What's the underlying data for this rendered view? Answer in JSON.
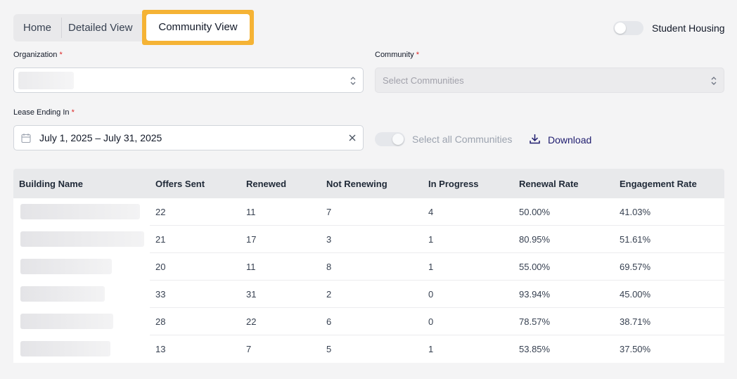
{
  "tabs": [
    {
      "label": "Home"
    },
    {
      "label": "Detailed View"
    },
    {
      "label": "Community View",
      "active": true
    }
  ],
  "student_housing": {
    "label": "Student Housing",
    "on": false
  },
  "organization": {
    "label": "Organization",
    "required": "*",
    "value": ""
  },
  "community": {
    "label": "Community",
    "required": "*",
    "placeholder": "Select Communities"
  },
  "lease": {
    "label": "Lease Ending In",
    "required": "*",
    "value": "July 1, 2025 – July 31, 2025"
  },
  "select_all": {
    "label": "Select all Communities"
  },
  "download": {
    "label": "Download"
  },
  "table": {
    "headers": [
      "Building Name",
      "Offers Sent",
      "Renewed",
      "Not Renewing",
      "In Progress",
      "Renewal Rate",
      "Engagement Rate"
    ],
    "rows": [
      {
        "building": "",
        "offers": "22",
        "renewed": "11",
        "not_renewing": "7",
        "in_progress": "4",
        "renewal_rate": "50.00%",
        "engagement_rate": "41.03%"
      },
      {
        "building": "",
        "offers": "21",
        "renewed": "17",
        "not_renewing": "3",
        "in_progress": "1",
        "renewal_rate": "80.95%",
        "engagement_rate": "51.61%"
      },
      {
        "building": "",
        "offers": "20",
        "renewed": "11",
        "not_renewing": "8",
        "in_progress": "1",
        "renewal_rate": "55.00%",
        "engagement_rate": "69.57%"
      },
      {
        "building": "",
        "offers": "33",
        "renewed": "31",
        "not_renewing": "2",
        "in_progress": "0",
        "renewal_rate": "93.94%",
        "engagement_rate": "45.00%"
      },
      {
        "building": "",
        "offers": "28",
        "renewed": "22",
        "not_renewing": "6",
        "in_progress": "0",
        "renewal_rate": "78.57%",
        "engagement_rate": "38.71%"
      },
      {
        "building": "",
        "offers": "13",
        "renewed": "7",
        "not_renewing": "5",
        "in_progress": "1",
        "renewal_rate": "53.85%",
        "engagement_rate": "37.50%"
      }
    ]
  },
  "colors": {
    "highlight": "#f5b335",
    "download": "#1e1b6e",
    "required": "#dc2626"
  }
}
